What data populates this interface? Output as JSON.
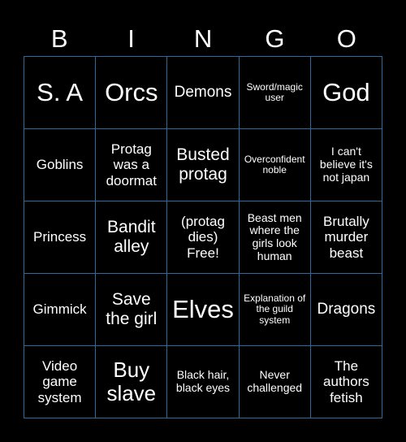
{
  "card": {
    "title": "BINGO",
    "background_color": "#000000",
    "text_color": "#ffffff",
    "grid_line_color": "#2d6a9f",
    "columns": 5,
    "rows": 5
  },
  "header": {
    "letters": [
      {
        "label": "B"
      },
      {
        "label": "I"
      },
      {
        "label": "N"
      },
      {
        "label": "G"
      },
      {
        "label": "O"
      }
    ]
  },
  "grid": {
    "cells": [
      {
        "id": "b1",
        "text": "S. A",
        "size": "xl"
      },
      {
        "id": "i1",
        "text": "Orcs",
        "size": "xl"
      },
      {
        "id": "n1",
        "text": "Demons",
        "size": "sm"
      },
      {
        "id": "g1",
        "text": "Sword/magic user",
        "size": "tiny"
      },
      {
        "id": "o1",
        "text": "God",
        "size": "xl"
      },
      {
        "id": "b2",
        "text": "Goblins",
        "size": "xs"
      },
      {
        "id": "i2",
        "text": "Protag was a doormat",
        "size": "xs"
      },
      {
        "id": "n2",
        "text": "Busted protag",
        "size": "md"
      },
      {
        "id": "g2",
        "text": "Overconfident noble",
        "size": "tiny"
      },
      {
        "id": "o2",
        "text": "I can't believe it's not japan",
        "size": "xxs"
      },
      {
        "id": "b3",
        "text": "Princess",
        "size": "xs"
      },
      {
        "id": "i3",
        "text": "Bandit alley",
        "size": "md"
      },
      {
        "id": "n3",
        "text": "(protag dies) Free!",
        "size": "xs"
      },
      {
        "id": "g3",
        "text": "Beast men where the girls look human",
        "size": "xxs"
      },
      {
        "id": "o3",
        "text": "Brutally murder beast",
        "size": "xs"
      },
      {
        "id": "b4",
        "text": "Gimmick",
        "size": "xs"
      },
      {
        "id": "i4",
        "text": "Save the girl",
        "size": "md"
      },
      {
        "id": "n4",
        "text": "Elves",
        "size": "xl"
      },
      {
        "id": "g4",
        "text": "Explanation of the guild system",
        "size": "tiny"
      },
      {
        "id": "o4",
        "text": "Dragons",
        "size": "sm"
      },
      {
        "id": "b5",
        "text": "Video game system",
        "size": "xs"
      },
      {
        "id": "i5",
        "text": "Buy slave",
        "size": "lg"
      },
      {
        "id": "n5",
        "text": "Black hair, black eyes",
        "size": "xxs"
      },
      {
        "id": "g5",
        "text": "Never challenged",
        "size": "xxs"
      },
      {
        "id": "o5",
        "text": "The authors fetish",
        "size": "xs"
      }
    ]
  }
}
